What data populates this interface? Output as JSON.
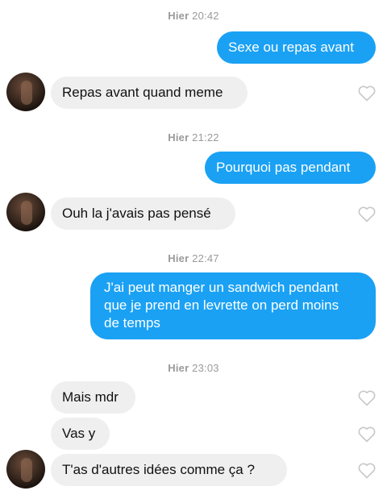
{
  "messages": [
    {
      "day": "Hier",
      "time": "20:42"
    },
    {
      "text": "Sexe ou repas avant"
    },
    {
      "text": "Repas avant quand meme"
    },
    {
      "day": "Hier",
      "time": "21:22"
    },
    {
      "text": "Pourquoi pas pendant"
    },
    {
      "text": "Ouh la j'avais pas pensé"
    },
    {
      "day": "Hier",
      "time": "22:47"
    },
    {
      "lines": [
        "J'ai peut manger un sandwich pendant",
        "que je prend en levrette on perd moins",
        "de temps"
      ]
    },
    {
      "day": "Hier",
      "time": "23:03"
    },
    {
      "text": "Mais mdr"
    },
    {
      "text": "Vas y"
    },
    {
      "text": "T'as d'autres idées comme ça ?"
    }
  ],
  "colors": {
    "sent_bubble": "#1aa1f4",
    "received_bubble": "#efefef",
    "timestamp": "#9a9a9a"
  },
  "icons": {
    "like": "heart-outline-icon",
    "avatar": "contact-avatar"
  }
}
